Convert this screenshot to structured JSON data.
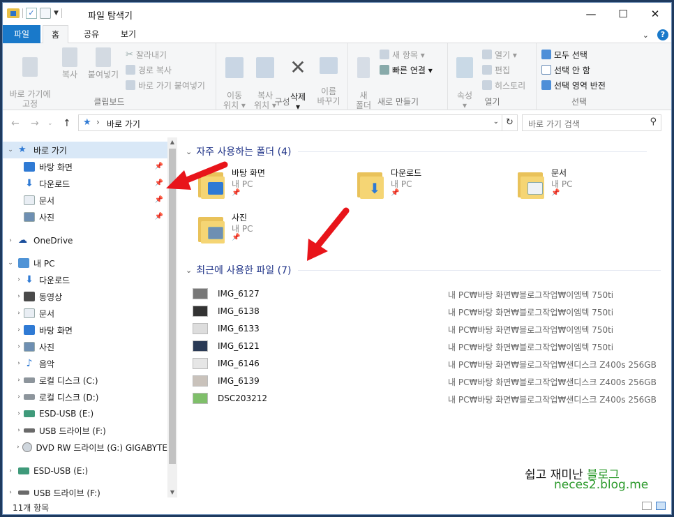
{
  "window": {
    "title": "파일 탐색기"
  },
  "controls": {
    "minimize": "—",
    "maximize": "☐",
    "close": "✕"
  },
  "tabs": {
    "file": "파일",
    "home": "홈",
    "share": "공유",
    "view": "보기"
  },
  "ribbon": {
    "clipboard": {
      "label": "클립보드",
      "pin": "바로 가기에\n고정",
      "copy": "복사",
      "paste": "붙여넣기",
      "cut": "잘라내기",
      "copy_path": "경로 복사",
      "paste_shortcut": "바로 가기 붙여넣기"
    },
    "organize": {
      "label": "구성",
      "move": "이동\n위치 ▾",
      "copy_to": "복사\n위치 ▾",
      "delete": "삭제\n▾",
      "rename": "이름\n바꾸기"
    },
    "new": {
      "label": "새로 만들기",
      "new_folder": "새\n폴더",
      "new_item": "새 항목 ▾",
      "easy_access": "빠른 연결 ▾"
    },
    "open": {
      "label": "열기",
      "properties": "속성\n▾",
      "open": "열기 ▾",
      "edit": "편집",
      "history": "히스토리"
    },
    "select": {
      "label": "선택",
      "select_all": "모두 선택",
      "select_none": "선택 안 함",
      "invert": "선택 영역 반전"
    }
  },
  "address": {
    "path": "바로 가기",
    "search_placeholder": "바로 가기 검색"
  },
  "nav": {
    "quick_access": "바로 가기",
    "quick_items": [
      "바탕 화면",
      "다운로드",
      "문서",
      "사진"
    ],
    "onedrive": "OneDrive",
    "this_pc": "내 PC",
    "pc_items": [
      "다운로드",
      "동영상",
      "문서",
      "바탕 화면",
      "사진",
      "음악",
      "로컬 디스크 (C:)",
      "로컬 디스크 (D:)",
      "ESD-USB (E:)",
      "USB 드라이브 (F:)",
      "DVD RW 드라이브 (G:) GIGABYTE"
    ],
    "esd": "ESD-USB (E:)",
    "usb": "USB 드라이브 (F:)"
  },
  "content": {
    "frequent_header": "자주 사용하는 폴더 (4)",
    "folders": [
      {
        "name": "바탕 화면",
        "loc": "내 PC"
      },
      {
        "name": "다운로드",
        "loc": "내 PC"
      },
      {
        "name": "문서",
        "loc": "내 PC"
      },
      {
        "name": "사진",
        "loc": "내 PC"
      }
    ],
    "recent_header": "최근에 사용한 파일 (7)",
    "files": [
      {
        "name": "IMG_6127",
        "path": "내 PC₩바탕 화면₩블로그작업₩이엠텍 750ti"
      },
      {
        "name": "IMG_6138",
        "path": "내 PC₩바탕 화면₩블로그작업₩이엠텍 750ti"
      },
      {
        "name": "IMG_6133",
        "path": "내 PC₩바탕 화면₩블로그작업₩이엠텍 750ti"
      },
      {
        "name": "IMG_6121",
        "path": "내 PC₩바탕 화면₩블로그작업₩이엠텍 750ti"
      },
      {
        "name": "IMG_6146",
        "path": "내 PC₩바탕 화면₩블로그작업₩샌디스크 Z400s 256GB"
      },
      {
        "name": "IMG_6139",
        "path": "내 PC₩바탕 화면₩블로그작업₩샌디스크 Z400s 256GB"
      },
      {
        "name": "DSC203212",
        "path": "내 PC₩바탕 화면₩블로그작업₩샌디스크 Z400s 256GB"
      }
    ]
  },
  "status": {
    "count": "11개 항목"
  },
  "watermark": {
    "line1_a": "쉽고 재미난 ",
    "line1_b": "블로그",
    "line2": "neces2.blog.me"
  },
  "colors": {
    "accent": "#1979ca",
    "arrow": "#e8141a",
    "watermark_green": "#2c9a2c"
  }
}
